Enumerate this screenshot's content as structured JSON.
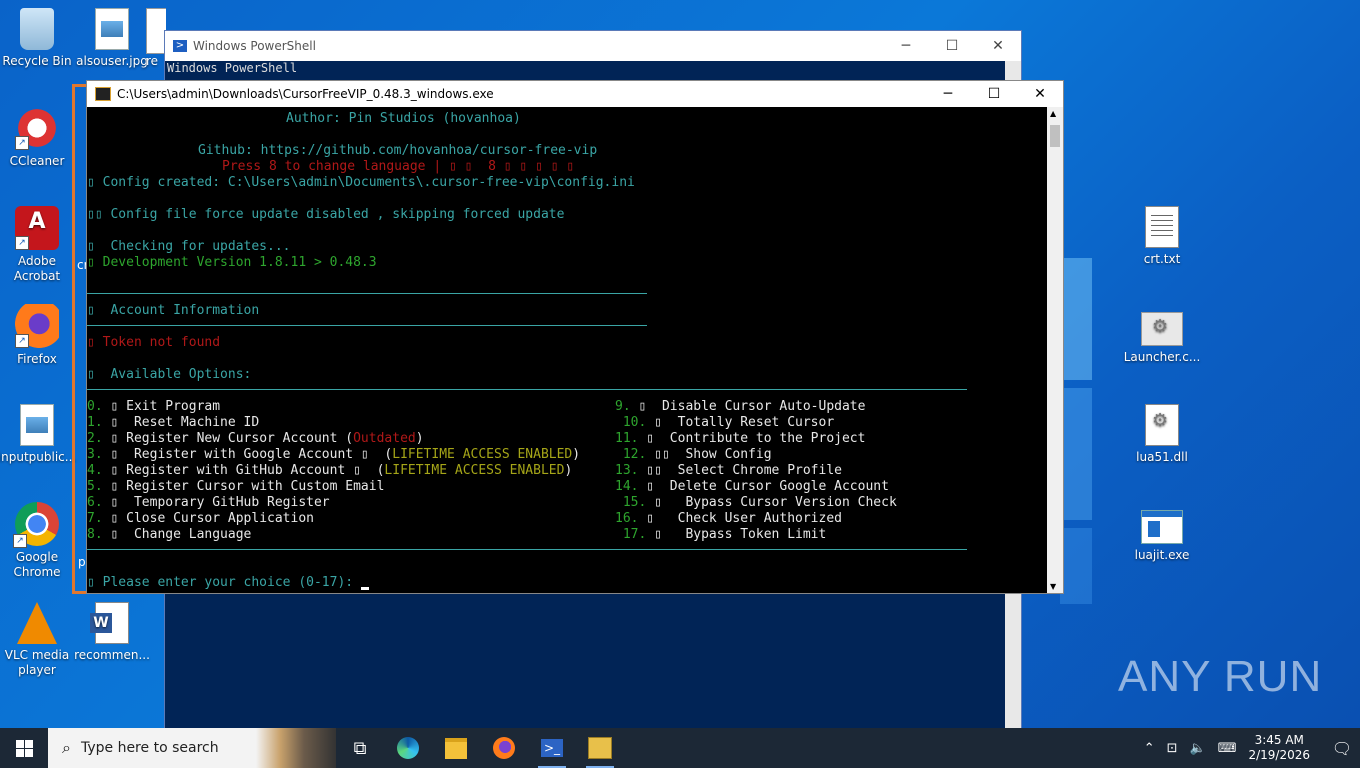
{
  "desktop": {
    "left_icons": [
      {
        "label": "Recycle Bin"
      },
      {
        "label": "alsouser.jpg"
      },
      {
        "label": "re"
      },
      {
        "label": "CCleaner"
      },
      {
        "label": "Adobe Acrobat"
      },
      {
        "label": "Firefox"
      },
      {
        "label": "inputpublic..."
      },
      {
        "label": "Google Chrome"
      },
      {
        "label": "VLC media player"
      },
      {
        "label": "recommen..."
      }
    ],
    "right_icons": [
      {
        "label": "crt.txt"
      },
      {
        "label": "Launcher.c..."
      },
      {
        "label": "lua51.dll"
      },
      {
        "label": "luajit.exe"
      }
    ],
    "partial_labels": {
      "cr": "cr",
      "p": "p"
    },
    "watermark": "ANY RUN"
  },
  "powershell": {
    "title": "Windows PowerShell",
    "line1": "Windows PowerShell"
  },
  "console": {
    "title": "C:\\Users\\admin\\Downloads\\CursorFreeVIP_0.48.3_windows.exe",
    "lines": {
      "author": "Author: Pin Studios (hovanhoa)",
      "github": "Github: https://github.com/hovanhoa/cursor-free-vip",
      "press": "Press 8 to change language | ▯ ▯  8 ▯ ▯ ▯ ▯ ▯",
      "config_created": "▯ Config created: C:\\Users\\admin\\Documents\\.cursor-free-vip\\config.ini",
      "force_update": "▯▯ Config file force update disabled , skipping forced update",
      "checking": "▯  Checking for updates...",
      "dev_version": "▯ Development Version 1.8.11 > 0.48.3",
      "account_info": "▯  Account Information",
      "token": "▯ Token not found",
      "available": "▯  Available Options:",
      "prompt": "▯ Please enter your choice (0-17): "
    },
    "options_left": [
      {
        "num": "0.",
        "text": " ▯ Exit Program"
      },
      {
        "num": "1.",
        "text": " ▯  Reset Machine ID"
      },
      {
        "num": "2.",
        "text": " ▯ Register New Cursor Account (",
        "tag": "Outdated",
        "tail": ")"
      },
      {
        "num": "3.",
        "text": " ▯  Register with Google Account ▯  (",
        "tag": "LIFETIME ACCESS ENABLED",
        "tail": ")"
      },
      {
        "num": "4.",
        "text": " ▯ Register with GitHub Account ▯  (",
        "tag": "LIFETIME ACCESS ENABLED",
        "tail": ")"
      },
      {
        "num": "5.",
        "text": " ▯ Register Cursor with Custom Email"
      },
      {
        "num": "6.",
        "text": " ▯  Temporary GitHub Register"
      },
      {
        "num": "7.",
        "text": " ▯ Close Cursor Application"
      },
      {
        "num": "8.",
        "text": " ▯  Change Language"
      }
    ],
    "options_right": [
      {
        "num": "9.",
        "text": " ▯  Disable Cursor Auto-Update"
      },
      {
        "num": " 10.",
        "text": " ▯  Totally Reset Cursor"
      },
      {
        "num": "11.",
        "text": " ▯  Contribute to the Project"
      },
      {
        "num": " 12.",
        "text": " ▯▯  Show Config"
      },
      {
        "num": "13.",
        "text": " ▯▯  Select Chrome Profile"
      },
      {
        "num": "14.",
        "text": " ▯  Delete Cursor Google Account"
      },
      {
        "num": " 15.",
        "text": " ▯   Bypass Cursor Version Check"
      },
      {
        "num": "16.",
        "text": " ▯   Check User Authorized"
      },
      {
        "num": " 17.",
        "text": " ▯   Bypass Token Limit"
      }
    ]
  },
  "taskbar": {
    "search_placeholder": "Type here to search",
    "time": "3:45 AM",
    "date": "2/19/2026"
  },
  "colors": {
    "cyan": "#3aa5a5",
    "green": "#2ea52e",
    "red": "#b01818",
    "yellow": "#a5a518",
    "desktop_blue": "#0b78d8",
    "selection_frame": "#e0772e"
  }
}
